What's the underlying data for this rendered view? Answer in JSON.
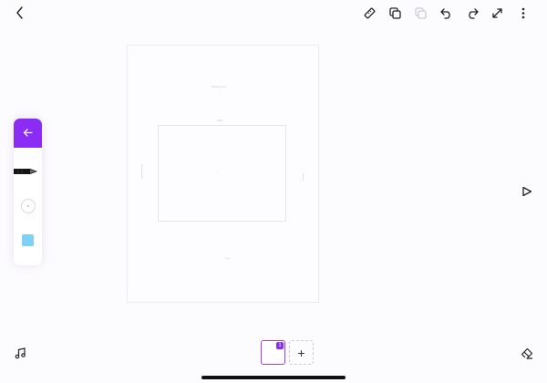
{
  "toolbar": {
    "back_icon": "chevron-left-icon",
    "actions": [
      {
        "name": "ruler-icon"
      },
      {
        "name": "duplicate-icon"
      },
      {
        "name": "layers-icon",
        "disabled": true
      },
      {
        "name": "undo-icon"
      },
      {
        "name": "redo-icon"
      },
      {
        "name": "expand-icon"
      },
      {
        "name": "more-vertical-icon"
      }
    ]
  },
  "canvas": {
    "heading_text": "heading text",
    "inner_label": "label",
    "center_marker": "+",
    "bottom_marker": "text"
  },
  "tools_panel": {
    "back_icon": "arrow-left-icon",
    "items": [
      "pen-tool",
      "circle-tool",
      "color-swatch"
    ],
    "swatch_color": "#7fd1f6",
    "accent": "#8a2cf3"
  },
  "play_icon": "play-icon",
  "music_icon": "music-note-icon",
  "pages": {
    "current_page": "1",
    "add_label": "+"
  },
  "eraser_icon": "eraser-icon"
}
